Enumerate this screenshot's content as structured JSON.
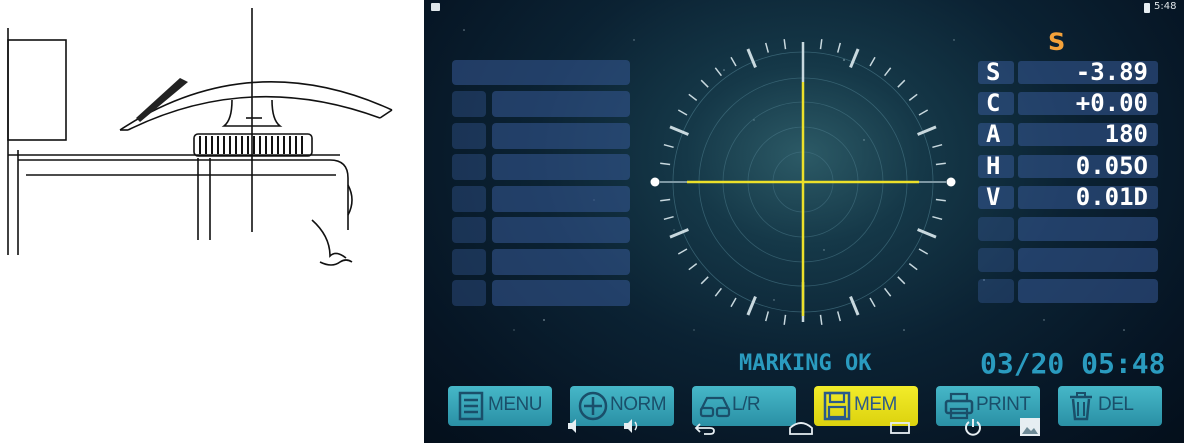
{
  "statusbar": {
    "time": "5:48"
  },
  "readout": {
    "mode": "S",
    "rows": [
      {
        "label": "S",
        "value": "-3.89"
      },
      {
        "label": "C",
        "value": "+0.00"
      },
      {
        "label": "A",
        "value": "180"
      },
      {
        "label": "H",
        "value": "0.05O"
      },
      {
        "label": "V",
        "value": "0.01D"
      }
    ]
  },
  "status_message": "MARKING OK",
  "datetime": "03/20 05:48",
  "buttons": [
    {
      "label": "MENU",
      "icon": "menu-list-icon"
    },
    {
      "label": "NORM",
      "icon": "circle-plus-icon"
    },
    {
      "label": "L/R",
      "icon": "glasses-icon"
    },
    {
      "label": "MEM",
      "icon": "floppy-disk-icon",
      "active": true
    },
    {
      "label": "PRINT",
      "icon": "printer-icon"
    },
    {
      "label": "DEL",
      "icon": "trash-icon"
    }
  ],
  "navbar": [
    "volume-down-icon",
    "volume-up-icon",
    "back-icon",
    "home-icon",
    "recent-apps-icon",
    "power-icon",
    "screenshot-icon"
  ],
  "colors": {
    "accent_yellow": "#f2ec2a",
    "button_teal": "#3aa7bb",
    "mode_orange": "#f4a23a",
    "status_blue": "#2a9bbf"
  }
}
